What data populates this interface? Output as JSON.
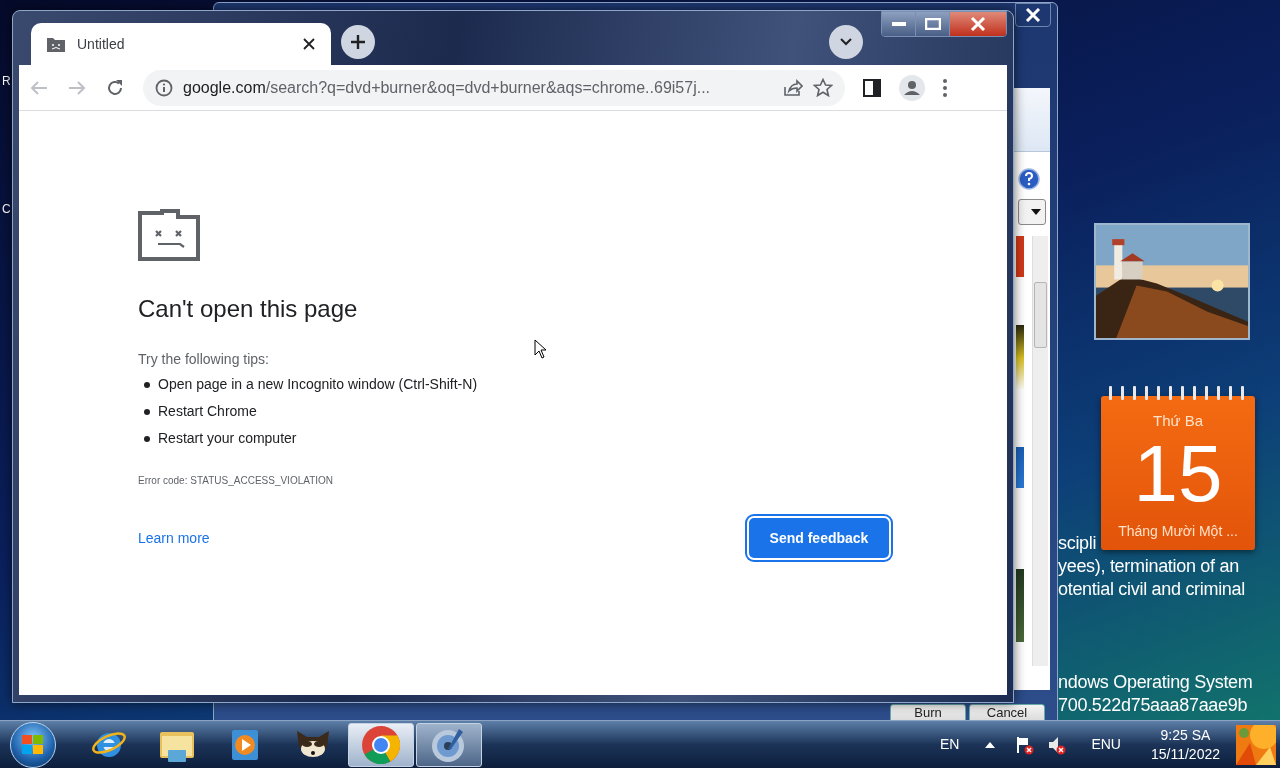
{
  "desktop": {
    "fragments": [
      "R",
      "C"
    ],
    "background_text": [
      "scipli",
      "yees), termination of an",
      "otential civil and criminal",
      "ndows Operating System",
      "700.522d75aaa87aae9b"
    ]
  },
  "back_window": {
    "buttons": [
      "Burn",
      "Cancel"
    ]
  },
  "browser": {
    "tab": {
      "title": "Untitled",
      "selected": true
    },
    "url_host": "google.com",
    "url_path": "/search?q=dvd+burner&oq=dvd+burner&aqs=chrome..69i57j...",
    "error": {
      "title": "Can't open this page",
      "tips_intro": "Try the following tips:",
      "tips": [
        "Open page in a new Incognito window (Ctrl-Shift-N)",
        "Restart Chrome",
        "Restart your computer"
      ],
      "error_code": "Error code: STATUS_ACCESS_VIOLATION",
      "learn_more": "Learn more",
      "feedback_button": "Send feedback"
    }
  },
  "calendar": {
    "weekday": "Thứ Ba",
    "day": "15",
    "month": "Tháng Mười Một ..."
  },
  "taskbar": {
    "apps": [
      {
        "kind": "browser-e",
        "running": false,
        "selected": false
      },
      {
        "kind": "folder",
        "running": false,
        "selected": false
      },
      {
        "kind": "player",
        "running": false,
        "selected": false
      },
      {
        "kind": "raccoon",
        "running": false,
        "selected": false
      },
      {
        "kind": "chrome",
        "running": true,
        "selected": true
      },
      {
        "kind": "disc",
        "running": true,
        "selected": false
      }
    ],
    "tray": {
      "language": "EN",
      "keyboard": "ENU",
      "time": "9:25 SA",
      "date": "15/11/2022"
    }
  }
}
